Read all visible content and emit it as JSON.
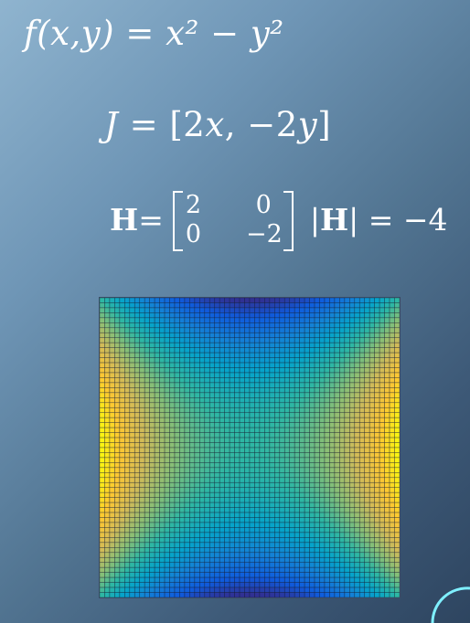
{
  "slide": {
    "function_eq": "f(x,y) = x² − y²",
    "jacobian": {
      "lhs": "J",
      "rhs": " = [2",
      "x": "x",
      "sep": ", −2",
      "y": "y",
      "end": "]"
    },
    "hessian": {
      "symbol": "H",
      "equals": " =",
      "matrix": [
        [
          "2",
          "0"
        ],
        [
          "0",
          "−2"
        ]
      ],
      "det_prefix": "|",
      "det_symbol": "H",
      "det_suffix": "| = −4"
    }
  },
  "surface_plot": {
    "function": "x^2 - y^2",
    "x_range": [
      -1,
      1
    ],
    "y_range": [
      -1,
      1
    ],
    "grid_count": 60,
    "colormap": "parula",
    "colormap_colors": [
      "#352a87",
      "#0f5cdd",
      "#1481d6",
      "#06a4ca",
      "#2eb7a4",
      "#87bf77",
      "#d1bb59",
      "#fec832",
      "#f9fb0e"
    ]
  },
  "decorations": {
    "accent_color": "#7ff0ff"
  }
}
